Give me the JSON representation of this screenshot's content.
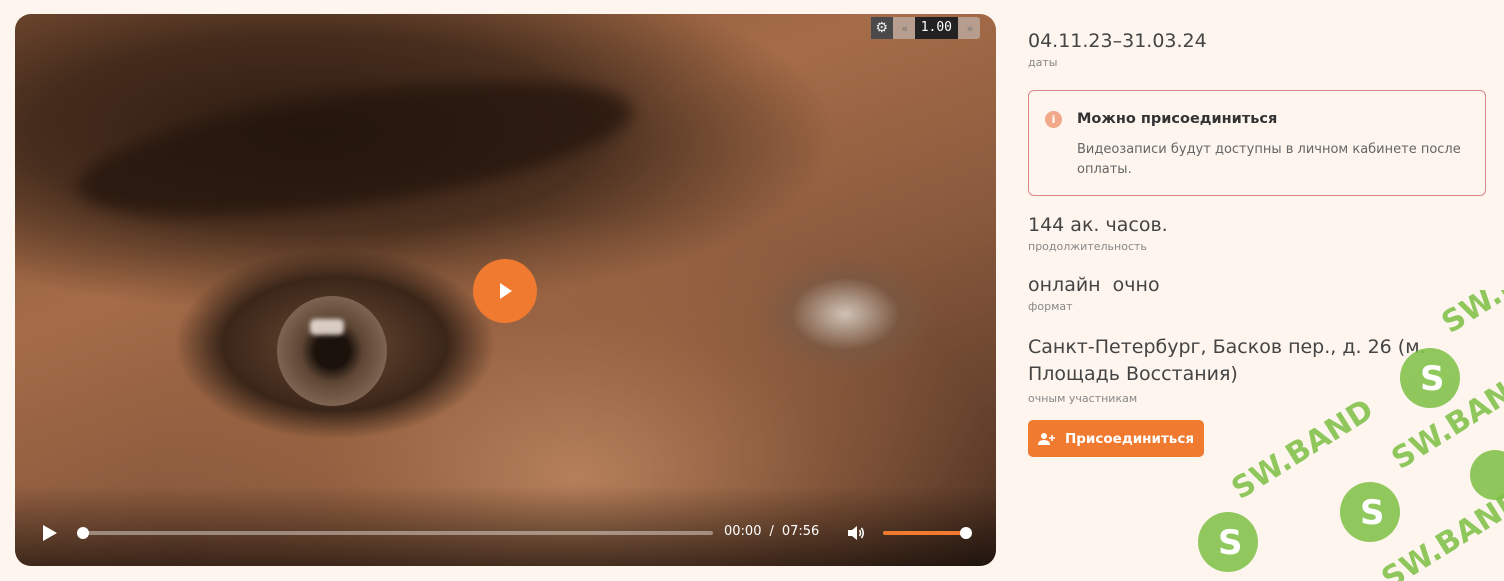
{
  "video": {
    "speed": "1.00",
    "current_time": "00:00",
    "time_separator": "/",
    "duration": "07:56",
    "progress": 0,
    "volume": 1.0
  },
  "course": {
    "dates": "04.11.23–31.03.24",
    "dates_label": "даты",
    "notice_title": "Можно присоединиться",
    "notice_text": "Видеозаписи будут доступны в личном кабинете после оплаты.",
    "hours": "144 ак. часов.",
    "hours_label": "продолжительность",
    "format": "онлайн  очно",
    "format_label": "формат",
    "address": "Санкт-Петербург, Басков пер., д. 26 (м. Площадь Восстания)",
    "address_label": "очным участникам",
    "join_label": "Присоединиться"
  },
  "watermark": {
    "text": "SW.BAND"
  },
  "colors": {
    "accent": "#f07a30",
    "notice_border": "#d9868a",
    "watermark": "#7cc043"
  }
}
